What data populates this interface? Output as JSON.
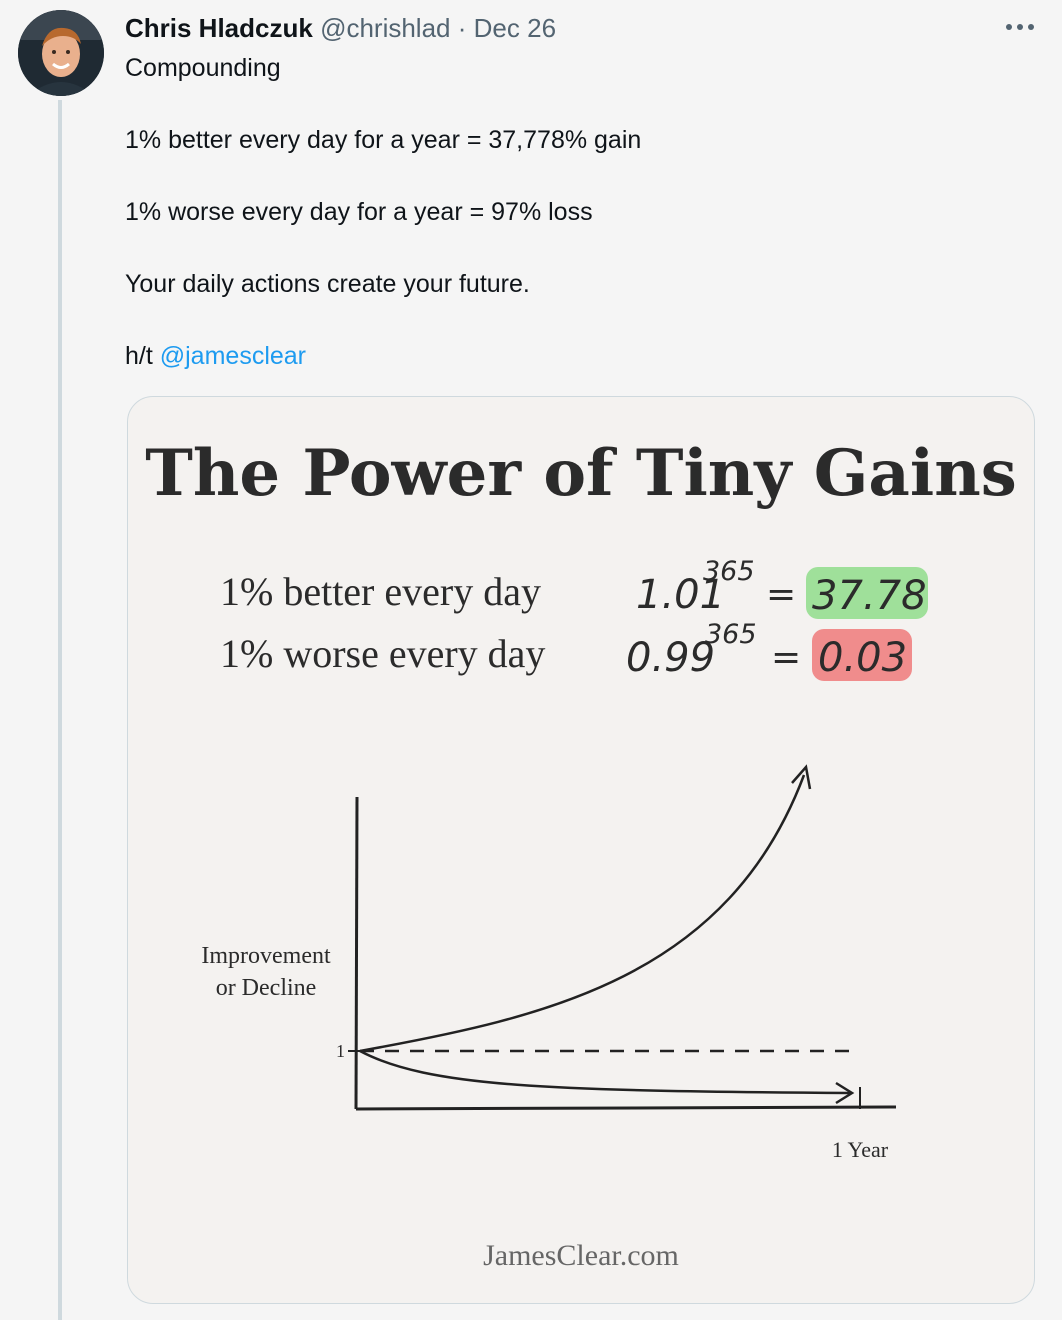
{
  "tweet": {
    "author_name": "Chris Hladczuk",
    "author_handle": "@chrishlad",
    "separator": "·",
    "date": "Dec 26",
    "more_icon": "more-horizontal-icon",
    "lines": [
      "Compounding",
      "1% better every day for a year = 37,778% gain",
      "1% worse every day for a year = 97% loss",
      "Your daily actions create your future.",
      "h/t"
    ],
    "mention": "@jamesclear"
  },
  "image": {
    "title": "The Power of Tiny Gains",
    "row1": {
      "label": "1% better every day",
      "base": "1.01",
      "exp": "365",
      "eq": "=",
      "result": "37.78",
      "highlight": "#9fe09a"
    },
    "row2": {
      "label": "1% worse every day",
      "base": "0.99",
      "exp": "365",
      "eq": "=",
      "result": "0.03",
      "highlight": "#f08c8c"
    },
    "ylabel_line1": "Improvement",
    "ylabel_line2": "or Decline",
    "y_tick": "1",
    "x_tick": "1 Year",
    "footer": "JamesClear.com"
  },
  "colors": {
    "mention": "#1d9bf0",
    "meta": "#536471"
  }
}
